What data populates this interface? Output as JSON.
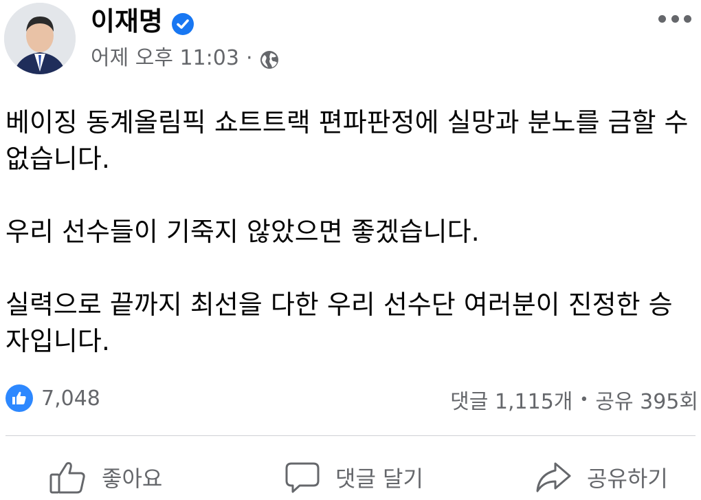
{
  "post": {
    "author": "이재명",
    "timestamp": "어제 오후 11:03",
    "separator": "·",
    "privacy_icon": "globe-icon",
    "paragraphs": [
      "베이징 동계올림픽 쇼트트랙 편파판정에 실망과 분노를 금할 수 없습니다.",
      "우리 선수들이 기죽지 않았으면 좋겠습니다.",
      "실력으로 끝까지 최선을 다한 우리 선수단 여러분이 진정한 승자입니다."
    ]
  },
  "stats": {
    "likes": "7,048",
    "comments": "댓글 1,115개",
    "dot": "•",
    "shares": "공유 395회"
  },
  "actions": {
    "like": "좋아요",
    "comment": "댓글 달기",
    "share": "공유하기"
  },
  "colors": {
    "accent": "#2d88ff",
    "secondary_text": "#65676b",
    "verified": "#1877f2"
  }
}
